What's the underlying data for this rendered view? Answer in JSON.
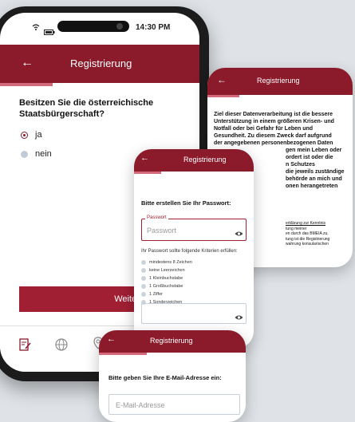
{
  "status": {
    "time": "14:30 PM"
  },
  "screen1": {
    "header_title": "Registrierung",
    "question": "Besitzen Sie die österreichische Staatsbürgerschaft?",
    "options": [
      {
        "label": "ja",
        "selected": true
      },
      {
        "label": "nein",
        "selected": false
      }
    ],
    "button_label": "Weiter"
  },
  "screen2": {
    "header_title": "Registrierung",
    "text_lines": [
      "Ziel dieser Datenverarbeitung ist die bessere",
      "Unterstützung in einem größeren Krisen- und",
      "Notfall oder bei Gefahr für Leben und",
      "Gesundheit. Zu diesem Zweck darf aufgrund",
      "der angegebenen personenbezogenen Daten",
      "gen mein Leben oder",
      "ordert ist oder die",
      "n Schutzes",
      "die jeweils zuständige",
      "behörde an mich und",
      "onen herangetreten"
    ],
    "small_text_lines": [
      "erklärung zur Kenntnis",
      "tung meiner",
      "en durch das BMEIA zu.",
      "tung ist die Registrierung",
      "wahrung konsularischen"
    ]
  },
  "screen3": {
    "header_title": "Registrierung",
    "prompt": "Bitte erstellen Sie Ihr Passwort:",
    "password_label": "Passwort",
    "password_placeholder": "Passwort",
    "criteria_heading": "Ihr Passwort sollte folgende Kriterien erfüllen:",
    "criteria": [
      "mindestens 8 Zeichen",
      "keine Leerzeichen",
      "1 Kleinbuchstabe",
      "1 Großbuchstabe",
      "1 Ziffer",
      "1 Sonderzeichen"
    ]
  },
  "screen4": {
    "header_title": "Registrierung",
    "prompt": "Bitte geben Sie Ihre E-Mail-Adresse ein:",
    "email_placeholder": "E-Mail-Adresse"
  },
  "colors": {
    "brand": "#8b1a2b",
    "button": "#a01f33",
    "accent": "#d26a7b"
  }
}
